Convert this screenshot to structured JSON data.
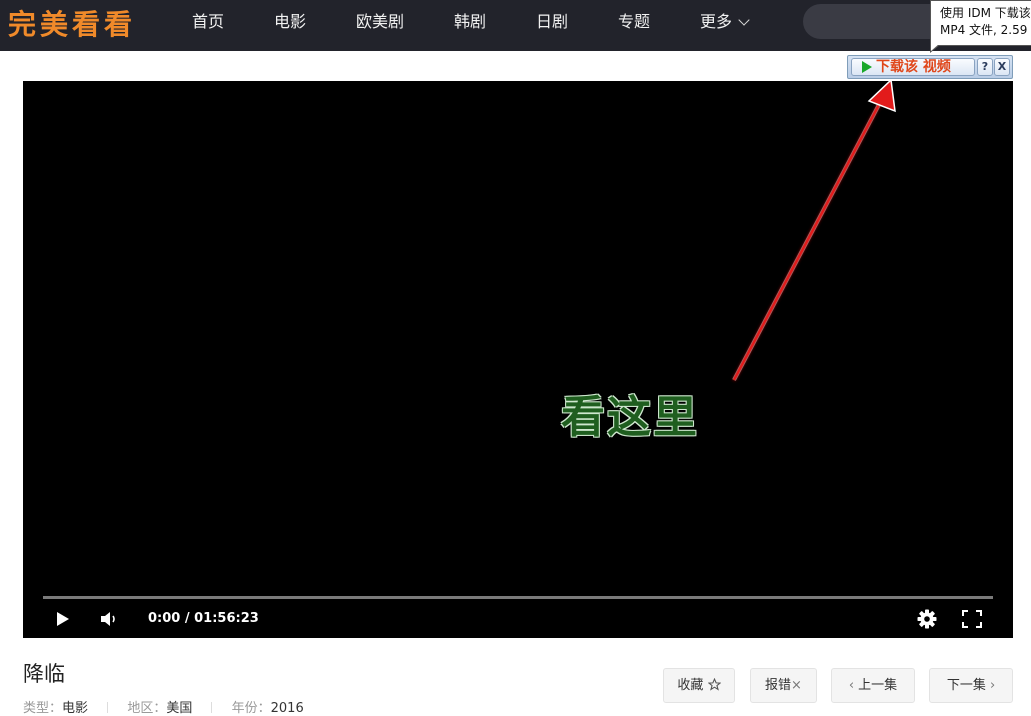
{
  "site": {
    "logo": "完美看看"
  },
  "nav": {
    "items": [
      "首页",
      "电影",
      "欧美剧",
      "韩剧",
      "日剧",
      "专题"
    ],
    "more_label": "更多"
  },
  "search": {
    "placeholder": ""
  },
  "idm": {
    "tooltip_line1": "使用 IDM 下载该",
    "tooltip_line2": "MP4 文件, 2.59 (",
    "download_label": "下载该 视频",
    "help_label": "?",
    "close_label": "X"
  },
  "video": {
    "overlay_text": "看这里",
    "time": "0:00 / 01:56:23",
    "progress": 0
  },
  "info": {
    "title": "降临",
    "type_label": "类型：",
    "type_value": "电影",
    "region_label": "地区：",
    "region_value": "美国",
    "year_label": "年份：",
    "year_value": "2016"
  },
  "actions": {
    "favorite": "收藏",
    "report": "报错",
    "prev": "上一集",
    "next": "下一集"
  },
  "colors": {
    "header_bg": "#22232b",
    "logo": "#f08a2a",
    "arrow": "#e21b1b",
    "idm_download_text": "#e0471b"
  }
}
